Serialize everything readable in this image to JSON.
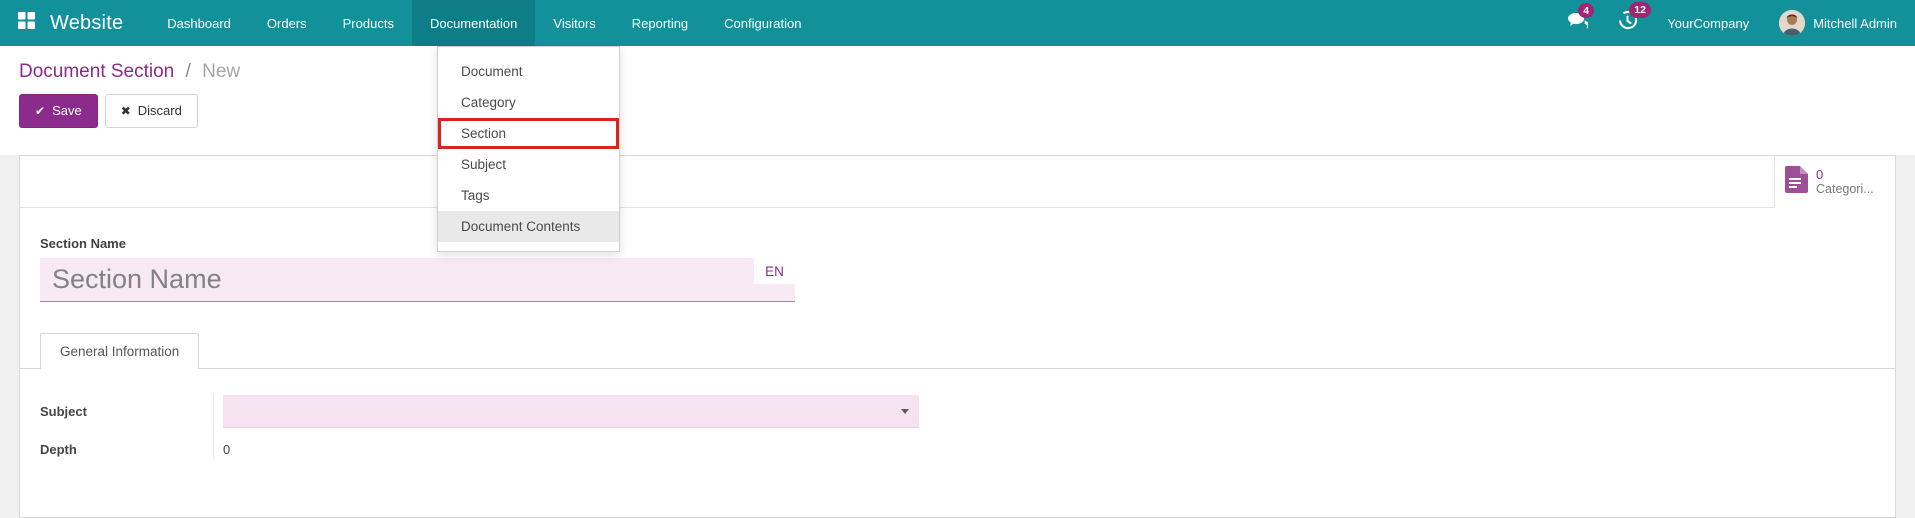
{
  "navbar": {
    "brand": "Website",
    "items": [
      {
        "label": "Dashboard",
        "active": false
      },
      {
        "label": "Orders",
        "active": false
      },
      {
        "label": "Products",
        "active": false
      },
      {
        "label": "Documentation",
        "active": true
      },
      {
        "label": "Visitors",
        "active": false
      },
      {
        "label": "Reporting",
        "active": false
      },
      {
        "label": "Configuration",
        "active": false
      }
    ],
    "messages_badge": "4",
    "activities_badge": "12",
    "company": "YourCompany",
    "user": "Mitchell Admin"
  },
  "dropdown": {
    "items": [
      {
        "label": "Document"
      },
      {
        "label": "Category"
      },
      {
        "label": "Section"
      },
      {
        "label": "Subject"
      },
      {
        "label": "Tags"
      },
      {
        "label": "Document Contents"
      }
    ]
  },
  "breadcrumb": {
    "parent": "Document Section",
    "separator": "/",
    "current": "New"
  },
  "actions": {
    "save_label": "Save",
    "save_glyph": "✔",
    "discard_label": "Discard",
    "discard_glyph": "✖"
  },
  "sheet": {
    "stat_button": {
      "count": "0",
      "label": "Categori..."
    },
    "section_name_label": "Section Name",
    "section_name_placeholder": "Section Name",
    "lang_badge": "EN",
    "tabs": [
      {
        "label": "General Information"
      }
    ],
    "fields": {
      "subject_label": "Subject",
      "depth_label": "Depth",
      "depth_value": "0"
    }
  },
  "colors": {
    "nav_teal": "#12919b",
    "nav_active_teal": "#0d7e88",
    "primary_purple": "#8b2b8c",
    "badge_magenta": "#a02573",
    "input_pink": "#f8e9f4",
    "annotation_red": "#d9251d"
  }
}
